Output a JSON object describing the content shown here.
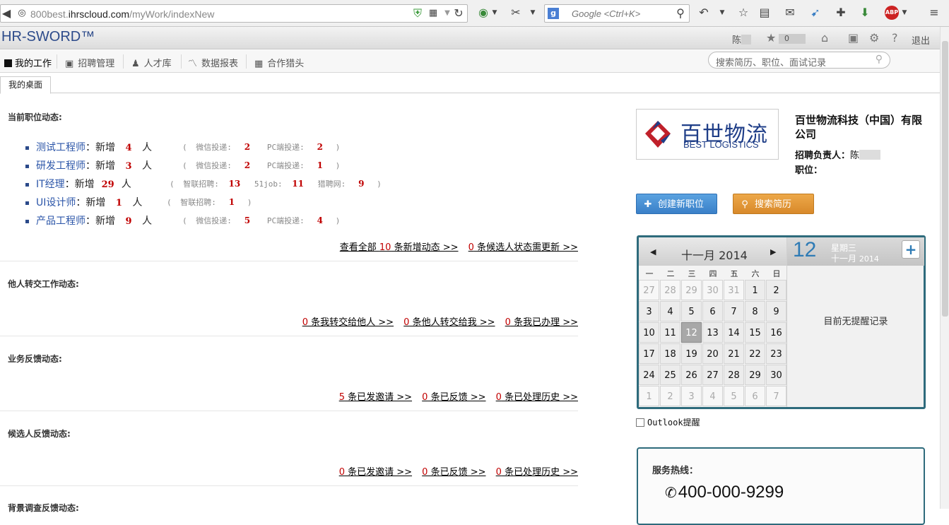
{
  "browser": {
    "url_prefix": "800best.",
    "url_domain": "ihrscloud.com",
    "url_path": "/myWork/indexNew",
    "search_placeholder": "Google <Ctrl+K>"
  },
  "header": {
    "logo": "HR-SWORD™",
    "user": "陈",
    "star_count": "0",
    "logout": "退出"
  },
  "nav": {
    "items": [
      {
        "label": "我的工作"
      },
      {
        "label": "招聘管理"
      },
      {
        "label": "人才库"
      },
      {
        "label": "数据报表"
      },
      {
        "label": "合作猎头"
      }
    ],
    "search_placeholder": "搜索简历、职位、面试记录"
  },
  "tab": {
    "label": "我的桌面"
  },
  "sections": {
    "current_jobs": {
      "title": "当前职位动态:",
      "jobs": [
        {
          "name": "测试工程师",
          "verb": "：新增",
          "count": "4",
          "unit": "人",
          "sources": [
            {
              "label": "微信投递:",
              "n": "2"
            },
            {
              "label": "PC端投递:",
              "n": "2"
            }
          ]
        },
        {
          "name": "研发工程师",
          "verb": "：新增",
          "count": "3",
          "unit": "人",
          "sources": [
            {
              "label": "微信投递:",
              "n": "2"
            },
            {
              "label": "PC端投递:",
              "n": "1"
            }
          ]
        },
        {
          "name": "IT经理",
          "verb": "：新增",
          "count": "29",
          "unit": "人",
          "sources": [
            {
              "label": "智联招聘:",
              "n": "13"
            },
            {
              "label": "51job:",
              "n": "11"
            },
            {
              "label": "猎聘网:",
              "n": "9"
            }
          ]
        },
        {
          "name": "UI设计师",
          "verb": "：新增",
          "count": "1",
          "unit": "人",
          "sources": [
            {
              "label": "智联招聘:",
              "n": "1"
            }
          ]
        },
        {
          "name": "产品工程师",
          "verb": "：新增",
          "count": "9",
          "unit": "人",
          "sources": [
            {
              "label": "微信投递:",
              "n": "5"
            },
            {
              "label": "PC端投递:",
              "n": "4"
            }
          ]
        }
      ],
      "links": [
        {
          "pre": "查看全部 ",
          "n": "10",
          "post": " 条新增动态 >>"
        },
        {
          "pre": "",
          "n": "0",
          "post": " 条候选人状态需更新 >>"
        }
      ]
    },
    "transfer": {
      "title": "他人转交工作动态:",
      "links": [
        {
          "n": "0",
          "post": " 条我转交给他人 >>"
        },
        {
          "n": "0",
          "post": " 条他人转交给我 >>"
        },
        {
          "n": "0",
          "post": " 条我已办理 >>"
        }
      ]
    },
    "business": {
      "title": "业务反馈动态:",
      "links": [
        {
          "n": "5",
          "post": " 条已发邀请 >>"
        },
        {
          "n": "0",
          "post": " 条已反馈 >>"
        },
        {
          "n": "0",
          "post": " 条已处理历史 >>"
        }
      ]
    },
    "candidate": {
      "title": "候选人反馈动态:",
      "links": [
        {
          "n": "0",
          "post": " 条已发邀请 >>"
        },
        {
          "n": "0",
          "post": " 条已反馈 >>"
        },
        {
          "n": "0",
          "post": " 条已处理历史 >>"
        }
      ]
    },
    "background": {
      "title": "背景调查反馈动态:"
    }
  },
  "company": {
    "logo_cn": "百世物流",
    "logo_en": "BEST LOGISTICS",
    "name": "百世物流科技（中国）有限公司",
    "recruiter_label": "招聘负责人：",
    "recruiter": "陈",
    "position_label": "职位："
  },
  "buttons": {
    "create": "创建新职位",
    "search": "搜索简历"
  },
  "calendar": {
    "month_title": "十一月 2014",
    "weekdays": [
      "一",
      "二",
      "三",
      "四",
      "五",
      "六",
      "日"
    ],
    "weeks": [
      [
        {
          "d": "27",
          "dim": true
        },
        {
          "d": "28",
          "dim": true
        },
        {
          "d": "29",
          "dim": true
        },
        {
          "d": "30",
          "dim": true
        },
        {
          "d": "31",
          "dim": true
        },
        {
          "d": "1"
        },
        {
          "d": "2"
        }
      ],
      [
        {
          "d": "3"
        },
        {
          "d": "4"
        },
        {
          "d": "5"
        },
        {
          "d": "6"
        },
        {
          "d": "7"
        },
        {
          "d": "8"
        },
        {
          "d": "9"
        }
      ],
      [
        {
          "d": "10"
        },
        {
          "d": "11"
        },
        {
          "d": "12",
          "today": true
        },
        {
          "d": "13"
        },
        {
          "d": "14"
        },
        {
          "d": "15"
        },
        {
          "d": "16"
        }
      ],
      [
        {
          "d": "17"
        },
        {
          "d": "18"
        },
        {
          "d": "19"
        },
        {
          "d": "20"
        },
        {
          "d": "21"
        },
        {
          "d": "22"
        },
        {
          "d": "23"
        }
      ],
      [
        {
          "d": "24"
        },
        {
          "d": "25"
        },
        {
          "d": "26"
        },
        {
          "d": "27"
        },
        {
          "d": "28"
        },
        {
          "d": "29"
        },
        {
          "d": "30"
        }
      ],
      [
        {
          "d": "1",
          "dim": true
        },
        {
          "d": "2",
          "dim": true
        },
        {
          "d": "3",
          "dim": true
        },
        {
          "d": "4",
          "dim": true
        },
        {
          "d": "5",
          "dim": true
        },
        {
          "d": "6",
          "dim": true
        },
        {
          "d": "7",
          "dim": true
        }
      ]
    ],
    "selected_day": "12",
    "selected_weekday": "星期三",
    "selected_month": "十一月",
    "selected_year": "2014",
    "no_reminders": "目前无提醒记录"
  },
  "outlook": {
    "label": "Outlook提醒"
  },
  "service": {
    "title": "服务热线：",
    "phone": "400-000-9299"
  },
  "colors": {
    "accent_blue": "#3a80c8",
    "accent_orange": "#d8892a",
    "count_red": "#c00000",
    "calendar_border": "#2e6b7c"
  }
}
